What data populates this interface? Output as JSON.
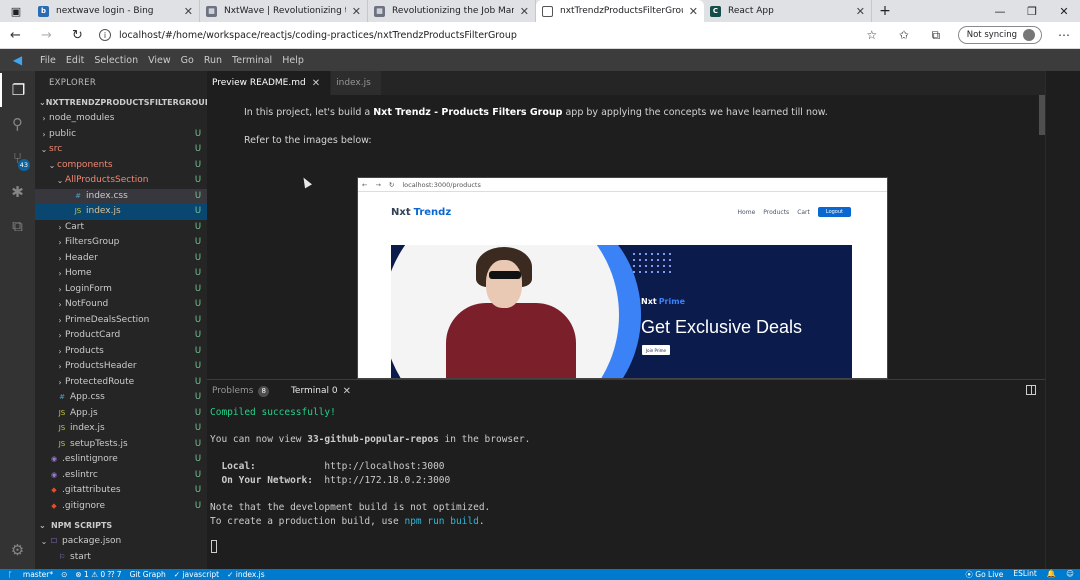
{
  "browser": {
    "tabs": [
      {
        "title": "nextwave login - Bing",
        "fav_color": "#2b6cb0",
        "fav": "b"
      },
      {
        "title": "NxtWave | Revolutionizing the Jo",
        "fav_color": "#6b7280",
        "fav": "▦"
      },
      {
        "title": "Revolutionizing the Job Market | N",
        "fav_color": "#6b7280",
        "fav": "▦"
      },
      {
        "title": "nxtTrendzProductsFilterGroup — ",
        "fav_color": "#ffffff",
        "fav": ""
      },
      {
        "title": "React App",
        "fav_color": "#134e4a",
        "fav": "C"
      }
    ],
    "url": "localhost/#/home/workspace/reactjs/coding-practices/nxtTrendzProductsFilterGroup",
    "sync_label": "Not syncing"
  },
  "menu": [
    "File",
    "Edit",
    "Selection",
    "View",
    "Go",
    "Run",
    "Terminal",
    "Help"
  ],
  "activity": {
    "scm_badge": "43"
  },
  "explorer": {
    "title": "EXPLORER",
    "section": "NXTTRENDZPRODUCTSFILTERGROUP",
    "rows": [
      {
        "name": "node_modules",
        "indent": 0,
        "chev": "›",
        "icon": "",
        "status": "",
        "cls": ""
      },
      {
        "name": "public",
        "indent": 0,
        "chev": "›",
        "icon": "",
        "status": "U",
        "cls": ""
      },
      {
        "name": "src",
        "indent": 0,
        "chev": "⌄",
        "icon": "",
        "status": "U",
        "cls": "red"
      },
      {
        "name": "components",
        "indent": 1,
        "chev": "⌄",
        "icon": "",
        "status": "U",
        "cls": "red"
      },
      {
        "name": "AllProductsSection",
        "indent": 2,
        "chev": "⌄",
        "icon": "",
        "status": "U",
        "cls": "red"
      },
      {
        "name": "index.css",
        "indent": 3,
        "chev": "",
        "icon": "#",
        "status": "U",
        "cls": "",
        "sel": true
      },
      {
        "name": "index.js",
        "indent": 3,
        "chev": "",
        "icon": "JS",
        "status": "U",
        "cls": "orange",
        "focus": true
      },
      {
        "name": "Cart",
        "indent": 2,
        "chev": "›",
        "icon": "",
        "status": "U",
        "cls": ""
      },
      {
        "name": "FiltersGroup",
        "indent": 2,
        "chev": "›",
        "icon": "",
        "status": "U",
        "cls": ""
      },
      {
        "name": "Header",
        "indent": 2,
        "chev": "›",
        "icon": "",
        "status": "U",
        "cls": ""
      },
      {
        "name": "Home",
        "indent": 2,
        "chev": "›",
        "icon": "",
        "status": "U",
        "cls": ""
      },
      {
        "name": "LoginForm",
        "indent": 2,
        "chev": "›",
        "icon": "",
        "status": "U",
        "cls": ""
      },
      {
        "name": "NotFound",
        "indent": 2,
        "chev": "›",
        "icon": "",
        "status": "U",
        "cls": ""
      },
      {
        "name": "PrimeDealsSection",
        "indent": 2,
        "chev": "›",
        "icon": "",
        "status": "U",
        "cls": ""
      },
      {
        "name": "ProductCard",
        "indent": 2,
        "chev": "›",
        "icon": "",
        "status": "U",
        "cls": ""
      },
      {
        "name": "Products",
        "indent": 2,
        "chev": "›",
        "icon": "",
        "status": "U",
        "cls": ""
      },
      {
        "name": "ProductsHeader",
        "indent": 2,
        "chev": "›",
        "icon": "",
        "status": "U",
        "cls": ""
      },
      {
        "name": "ProtectedRoute",
        "indent": 2,
        "chev": "›",
        "icon": "",
        "status": "U",
        "cls": ""
      },
      {
        "name": "App.css",
        "indent": 1,
        "chev": "",
        "icon": "#",
        "status": "U",
        "cls": ""
      },
      {
        "name": "App.js",
        "indent": 1,
        "chev": "",
        "icon": "JS",
        "status": "U",
        "cls": ""
      },
      {
        "name": "index.js",
        "indent": 1,
        "chev": "",
        "icon": "JS",
        "status": "U",
        "cls": ""
      },
      {
        "name": "setupTests.js",
        "indent": 1,
        "chev": "",
        "icon": "JS",
        "status": "U",
        "cls": ""
      },
      {
        "name": ".eslintignore",
        "indent": 0,
        "chev": "",
        "icon": "◉",
        "status": "U",
        "cls": ""
      },
      {
        "name": ".eslintrc",
        "indent": 0,
        "chev": "",
        "icon": "◉",
        "status": "U",
        "cls": ""
      },
      {
        "name": ".gitattributes",
        "indent": 0,
        "chev": "",
        "icon": "◆",
        "status": "U",
        "cls": ""
      },
      {
        "name": ".gitignore",
        "indent": 0,
        "chev": "",
        "icon": "◆",
        "status": "U",
        "cls": ""
      }
    ],
    "npm_section": "NPM SCRIPTS",
    "npm_rows": [
      {
        "name": "package.json",
        "indent": 0,
        "chev": "⌄",
        "icon": "☐"
      },
      {
        "name": "start",
        "indent": 1,
        "chev": "",
        "icon": "⚐"
      }
    ]
  },
  "editor": {
    "tabs": [
      {
        "label": "Preview README.md",
        "active": true
      },
      {
        "label": "index.js",
        "active": false
      }
    ],
    "preview": {
      "p1_before": "In this project, let's build a ",
      "p1_bold": "Nxt Trendz - Products Filters Group",
      "p1_after": " app by applying the concepts we have learned till now.",
      "p2": "Refer to the images below:",
      "mock": {
        "url": "localhost:3000/products",
        "logo_a": "Nxt",
        "logo_b": "Trendz",
        "links": [
          "Home",
          "Products",
          "Cart"
        ],
        "login": "Logout",
        "banner_brand_a": "Nxt",
        "banner_brand_b": "Prime",
        "banner_title": "Get Exclusive Deals",
        "banner_btn": "Join Prime"
      }
    }
  },
  "panel": {
    "problems_label": "Problems",
    "problems_count": "8",
    "terminal_label": "Terminal 0",
    "lines": {
      "compiled": "Compiled successfully!",
      "view_a": "You can now view ",
      "view_b": "33-github-popular-repos",
      "view_c": " in the browser.",
      "local_label": "  Local:",
      "local_url": "http://localhost:3000",
      "net_label": "  On Your Network:",
      "net_url": "http://172.18.0.2:3000",
      "note": "Note that the development build is not optimized.",
      "create_a": "To create a production build, use ",
      "create_b": "npm run build",
      "create_c": "."
    }
  },
  "status": {
    "branch": "master*",
    "errors": "⊗ 1 ⚠ 0 ⁇ 7",
    "git_graph": "Git Graph",
    "lang": "✓ javascript",
    "file": "✓ index.js",
    "golive": "⦿ Go Live",
    "eslint": "ESLint",
    "bell": "🔔"
  }
}
